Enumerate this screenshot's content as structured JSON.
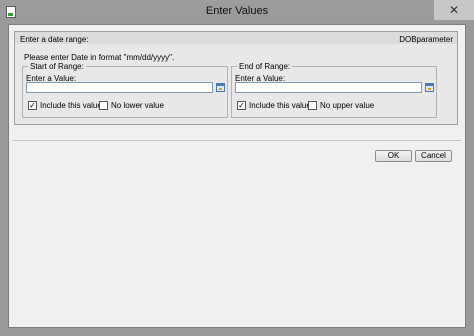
{
  "window": {
    "title": "Enter Values",
    "close_symbol": "✕"
  },
  "panel": {
    "title": "Enter a date range:",
    "param_name": "DOBparameter",
    "instruction": "Please enter Date in format \"mm/dd/yyyy\"."
  },
  "start": {
    "group_label": "Start of Range:",
    "field_label": "Enter a Value:",
    "value": "",
    "include_label": "Include this value",
    "include_checked": true,
    "check_mark": "✓",
    "no_bound_label": "No lower value",
    "no_bound_checked": false
  },
  "end": {
    "group_label": "End of Range:",
    "field_label": "Enter a Value:",
    "value": "",
    "include_label": "Include this value",
    "include_checked": true,
    "check_mark": "✓",
    "no_bound_label": "No upper value",
    "no_bound_checked": false
  },
  "buttons": {
    "ok": "OK",
    "cancel": "Cancel"
  }
}
